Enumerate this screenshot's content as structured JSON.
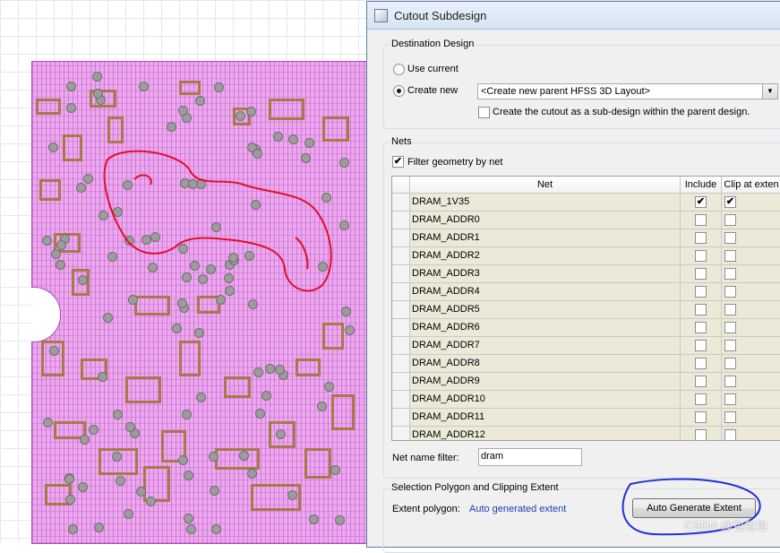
{
  "dialog": {
    "title": "Cutout Subdesign",
    "destination": {
      "legend": "Destination Design",
      "use_current_label": "Use current",
      "create_new_label": "Create new",
      "selected": "create_new",
      "parent_design_value": "<Create new parent HFSS 3D Layout>",
      "subdesign_checkbox_label": "Create the cutout as a sub-design within the parent design.",
      "subdesign_checked": false
    },
    "nets": {
      "legend": "Nets",
      "filter_label": "Filter geometry by net",
      "filter_checked": true,
      "columns": [
        "Net",
        "Include",
        "Clip at exten"
      ],
      "rows": [
        {
          "name": "DRAM_1V35",
          "include": true,
          "clip": true
        },
        {
          "name": "DRAM_ADDR0",
          "include": false,
          "clip": false
        },
        {
          "name": "DRAM_ADDR1",
          "include": false,
          "clip": false
        },
        {
          "name": "DRAM_ADDR2",
          "include": false,
          "clip": false
        },
        {
          "name": "DRAM_ADDR3",
          "include": false,
          "clip": false
        },
        {
          "name": "DRAM_ADDR4",
          "include": false,
          "clip": false
        },
        {
          "name": "DRAM_ADDR5",
          "include": false,
          "clip": false
        },
        {
          "name": "DRAM_ADDR6",
          "include": false,
          "clip": false
        },
        {
          "name": "DRAM_ADDR7",
          "include": false,
          "clip": false
        },
        {
          "name": "DRAM_ADDR8",
          "include": false,
          "clip": false
        },
        {
          "name": "DRAM_ADDR9",
          "include": false,
          "clip": false
        },
        {
          "name": "DRAM_ADDR10",
          "include": false,
          "clip": false
        },
        {
          "name": "DRAM_ADDR11",
          "include": false,
          "clip": false
        },
        {
          "name": "DRAM_ADDR12",
          "include": false,
          "clip": false
        }
      ],
      "name_filter_label": "Net name filter:",
      "name_filter_value": "dram"
    },
    "selection": {
      "legend": "Selection Polygon and Clipping Extent",
      "extent_label": "Extent polygon:",
      "extent_value": "Auto generated extent",
      "auto_generate_button": "Auto Generate Extent"
    }
  },
  "watermark": "CSDN @包包包",
  "colors": {
    "board_fill": "#e9a9ec",
    "trace": "#c850cd",
    "pad": "#a8794a",
    "annotation_red": "#e0102a",
    "annotation_blue": "#1f2fd8",
    "link": "#1a3fb0"
  }
}
